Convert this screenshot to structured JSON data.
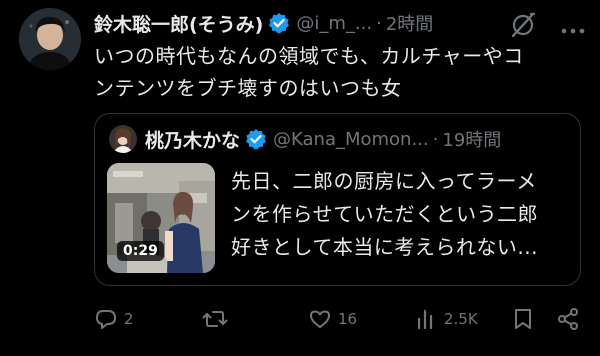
{
  "tweet": {
    "display_name": "鈴木聡一郎(そうみ)",
    "handle": "@i_m_...",
    "separator": "·",
    "time": "2時間",
    "text_lines": [
      "いつの時代もなんの領域でも、カルチャーやコ",
      "ンテンツをブチ壊すのはいつも女"
    ],
    "avatar_icon": "profile-photo"
  },
  "quote": {
    "display_name": "桃乃木かな",
    "handle": "@Kana_Momon...",
    "separator": "·",
    "time": "19時間",
    "text_lines": [
      "先日、二郎の厨房に入ってラーメ",
      "ンを作らせていただくという二郎",
      "好きとして本当に考えられない..."
    ],
    "video_duration": "0:29"
  },
  "actions": {
    "replies": "2",
    "reposts": "",
    "likes": "16",
    "views": "2.5K"
  },
  "icons": {
    "verified": "verified-badge-icon",
    "grok": "grok-icon",
    "more": "more-icon",
    "reply": "reply-icon",
    "repost": "repost-icon",
    "like": "heart-icon",
    "views": "views-icon",
    "bookmark": "bookmark-icon",
    "share": "share-icon"
  },
  "colors": {
    "background": "#000000",
    "text": "#e7e9ea",
    "muted": "#71767b",
    "verified": "#1d9bf0",
    "border": "#2f3336"
  }
}
